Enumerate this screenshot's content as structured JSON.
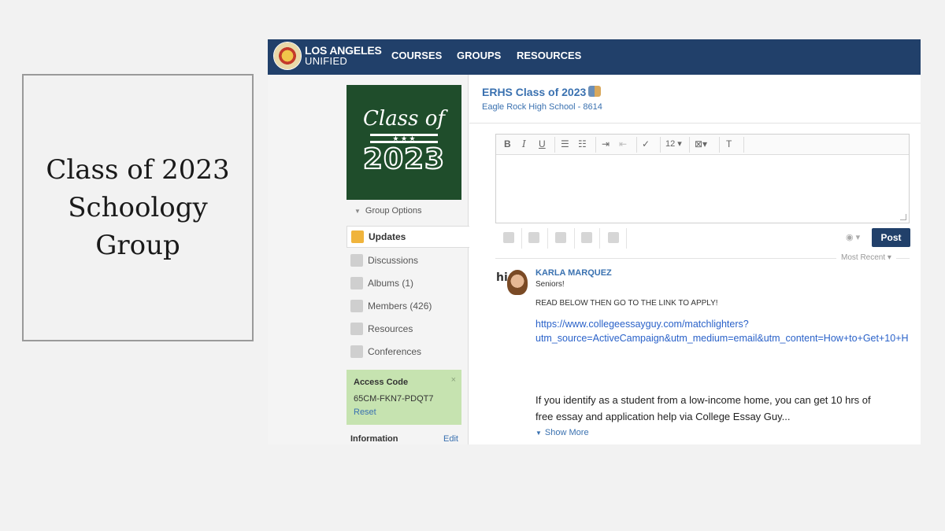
{
  "slide": {
    "title_lines": [
      "Class of 2023",
      "Schoology",
      "Group"
    ]
  },
  "nav": {
    "logo_line1": "LOS ANGELES",
    "logo_line2": "UNIFIED",
    "items": [
      "COURSES",
      "GROUPS",
      "RESOURCES"
    ]
  },
  "group": {
    "image_script": "Class of",
    "image_stars": "★ ★ ★",
    "image_year": "2023",
    "options_label": "Group Options",
    "title": "ERHS Class of 2023",
    "subtitle": "Eagle Rock High School - 8614"
  },
  "sidebar": {
    "items": [
      {
        "label": "Updates",
        "icon": "updates-icon",
        "active": true
      },
      {
        "label": "Discussions",
        "icon": "discussions-icon"
      },
      {
        "label": "Albums (1)",
        "icon": "albums-icon"
      },
      {
        "label": "Members (426)",
        "icon": "members-icon"
      },
      {
        "label": "Resources",
        "icon": "resources-icon"
      },
      {
        "label": "Conferences",
        "icon": "conferences-icon"
      }
    ],
    "access": {
      "title": "Access Code",
      "close": "×",
      "code": "65CM-FKN7-PDQT7",
      "reset": "Reset"
    },
    "info": {
      "title": "Information",
      "edit": "Edit"
    }
  },
  "editor": {
    "toolbar": {
      "bold": "B",
      "italic": "I",
      "underline": "U",
      "font_size": "12 ▾",
      "clear": "T"
    },
    "post_label": "Post",
    "privacy": "◉ ▾"
  },
  "feed": {
    "sort_label": "Most Recent ▾",
    "post": {
      "avatar_text": "hi",
      "author": "KARLA MARQUEZ",
      "line1": "Seniors!",
      "line2": "READ BELOW THEN GO TO THE LINK TO APPLY!",
      "link_line1": "https://www.collegeessayguy.com/matchlighters?",
      "link_line2": "utm_source=ActiveCampaign&utm_medium=email&utm_content=How+to+Get+10+H",
      "body_line1": "If you identify as a student from a low-income home, you can get 10 hrs of",
      "body_line2": "free essay and application help via College Essay Guy...",
      "show_more": "Show More"
    }
  }
}
